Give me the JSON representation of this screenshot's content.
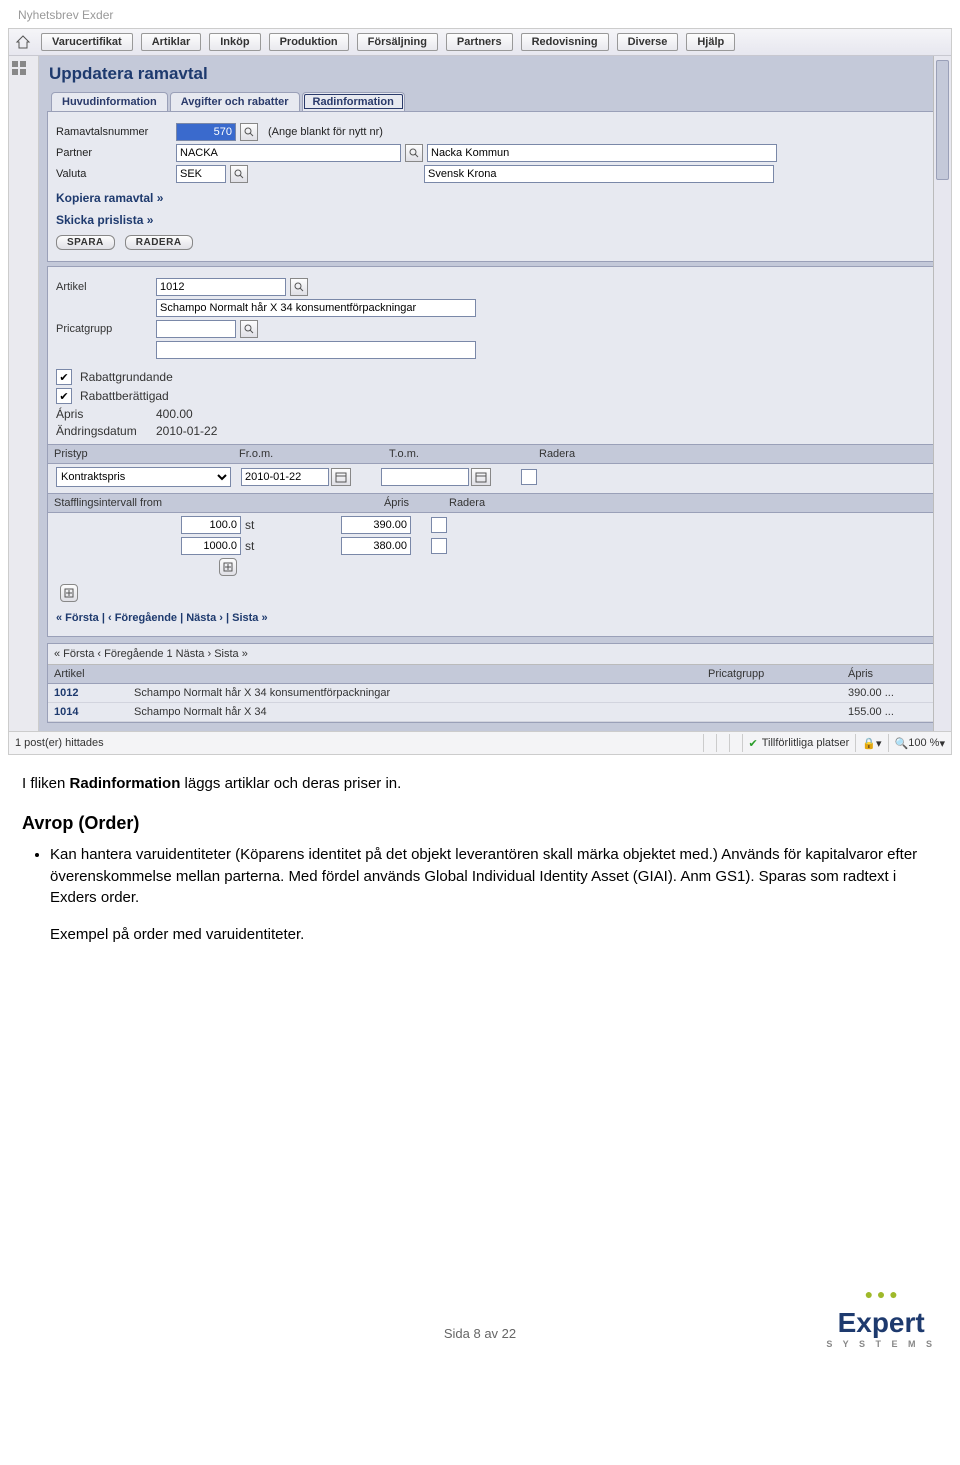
{
  "doc_header": "Nyhetsbrev Exder",
  "menubar": {
    "items": [
      "Varucertifikat",
      "Artiklar",
      "Inköp",
      "Produktion",
      "Försäljning",
      "Partners",
      "Redovisning",
      "Diverse",
      "Hjälp"
    ]
  },
  "page_title": "Uppdatera ramavtal",
  "tabs": [
    "Huvudinformation",
    "Avgifter och rabatter",
    "Radinformation"
  ],
  "active_tab_index": 2,
  "form": {
    "ramavtal_label": "Ramavtalsnummer",
    "ramavtal_value": "570",
    "ramavtal_note": "(Ange blankt för nytt nr)",
    "partner_label": "Partner",
    "partner_value": "NACKA",
    "partner_desc": "Nacka Kommun",
    "valuta_label": "Valuta",
    "valuta_value": "SEK",
    "valuta_desc": "Svensk Krona"
  },
  "link_kopiera": "Kopiera ramavtal »",
  "link_skicka": "Skicka prislista »",
  "btn_spara": "SPARA",
  "btn_radera": "RADERA",
  "article": {
    "artikel_label": "Artikel",
    "artikel_value": "1012",
    "artikel_desc": "Schampo Normalt hår X 34 konsumentförpackningar",
    "pricat_label": "Pricatgrupp",
    "pricat_value": "",
    "pricat_desc": "",
    "rabattgrundande_label": "Rabattgrundande",
    "rabattberattigad_label": "Rabattberättigad",
    "apris_label": "Ápris",
    "apris_value": "400.00",
    "andrings_label": "Ändringsdatum",
    "andrings_value": "2010-01-22"
  },
  "price_grid": {
    "headers": {
      "pristyp": "Pristyp",
      "from": "Fr.o.m.",
      "tom": "T.o.m.",
      "radera": "Radera"
    },
    "pristyp_value": "Kontraktspris",
    "from_value": "2010-01-22",
    "tom_value": ""
  },
  "staffling": {
    "header_from": "Stafflingsintervall from",
    "header_apris": "Ápris",
    "header_radera": "Radera",
    "rows": [
      {
        "from": "100.0",
        "unit": "st",
        "apris": "390.00"
      },
      {
        "from": "1000.0",
        "unit": "st",
        "apris": "380.00"
      }
    ]
  },
  "pager": "« Första  |  ‹ Föregående  |  Nästa ›  |  Sista »",
  "lower": {
    "nav": "« Första  ‹ Föregående  1  Nästa ›  Sista »",
    "cols": {
      "artikel": "Artikel",
      "desc": "",
      "pricat": "Pricatgrupp",
      "apris": "Ápris"
    },
    "rows": [
      {
        "id": "1012",
        "desc": "Schampo Normalt hår X 34 konsumentförpackningar",
        "pricat": "",
        "apris": "390.00 ..."
      },
      {
        "id": "1014",
        "desc": "Schampo Normalt hår X 34",
        "pricat": "",
        "apris": "155.00 ..."
      }
    ]
  },
  "statusbar": {
    "posts": "1 post(er) hittades",
    "trusted": "Tillförlitliga platser",
    "zoom": "100 %"
  },
  "body": {
    "p1_pre": "I fliken ",
    "p1_bold": "Radinformation",
    "p1_post": " läggs artiklar och deras priser in.",
    "h2": "Avrop (Order)",
    "li1": "Kan hantera varuidentiteter (Köparens identitet på det objekt leverantören skall märka objektet med.) Används för kapitalvaror efter överenskommelse mellan parterna. Med fördel används Global Individual Identity Asset (GIAI). Anm GS1). Sparas som radtext i Exders order.",
    "p2": "Exempel på order med varuidentiteter."
  },
  "footer": {
    "page": "Sida 8 av 22",
    "logo_text": "Expert",
    "logo_sub": "S Y S T E M S"
  }
}
